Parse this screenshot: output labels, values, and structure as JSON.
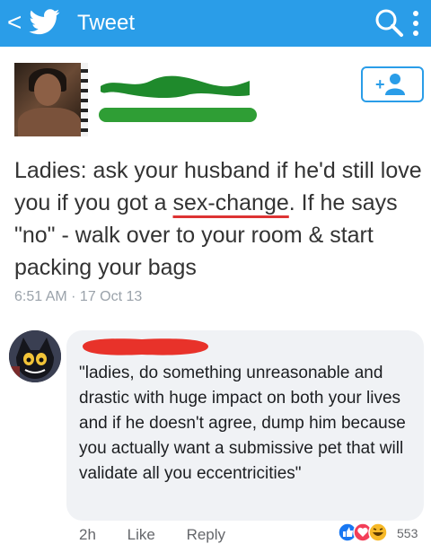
{
  "topbar": {
    "title": "Tweet",
    "back_glyph": "<",
    "icons": [
      "back-icon",
      "twitter-bird-icon",
      "search-icon",
      "more-vertical-icon"
    ],
    "color": "#2a9de8"
  },
  "tweet": {
    "text_before": "Ladies: ask your husband if he'd still love you if you got a ",
    "text_underlined": "sex-change",
    "text_after": ". If he says \"no\" - walk over to your room & start packing your bags",
    "timestamp": "6:51 AM · 17 Oct 13",
    "follow_icon": "add-user-icon",
    "redaction_colors": [
      "#1f8a2c",
      "#2f9e35"
    ]
  },
  "comment": {
    "text": "\"ladies, do something unreasonable and drastic with huge impact on both your lives and if he doesn't agree, dump him because you actually want a submissive pet that will validate all you eccentricities\"",
    "time": "2h",
    "like_label": "Like",
    "reply_label": "Reply",
    "reaction_count": "553",
    "reaction_icons": [
      "like-icon",
      "love-icon",
      "haha-icon"
    ],
    "redaction_color": "#e8322a"
  }
}
